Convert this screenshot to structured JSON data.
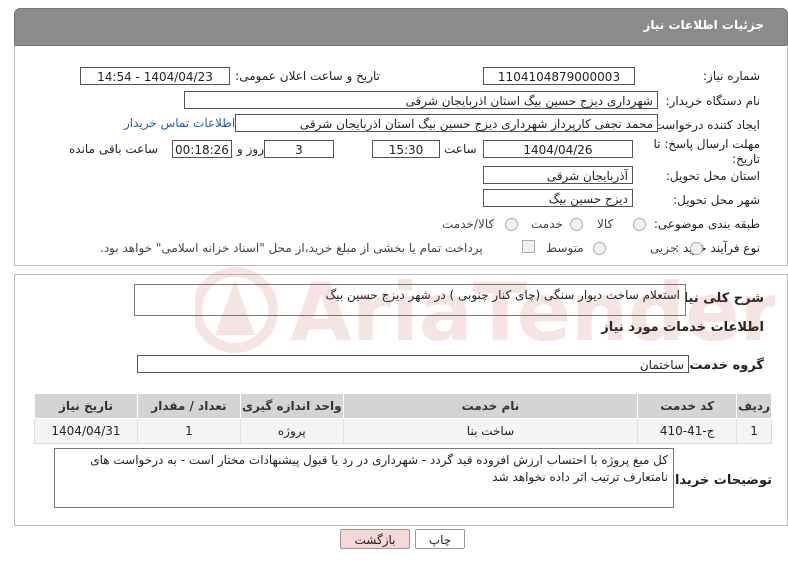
{
  "header": {
    "title": "جزئیات اطلاعات نیاز"
  },
  "fields": {
    "need_number_label": "شماره نیاز:",
    "need_number": "1104104879000003",
    "announce_label": "تاریخ و ساعت اعلان عمومی:",
    "announce_value": "1404/04/23 - 14:54",
    "buyer_label": "نام دستگاه خریدار:",
    "buyer_value": "شهرداری دیزج حسین بیگ استان اذربایجان شرقی",
    "creator_label": "ایجاد کننده درخواست:",
    "creator_value": "محمد نجفی کارپرداز شهرداری دیزج حسین بیگ استان اذربایجان شرقی",
    "contact_link": "اطلاعات تماس خریدار",
    "deadline_label": "مهلت ارسال پاسخ: تا تاریخ:",
    "deadline_date": "1404/04/26",
    "time_label": "ساعت",
    "deadline_time": "15:30",
    "days_value": "3",
    "days_label": "روز و",
    "remaining_value": "00:18:26",
    "remaining_label": "ساعت باقی مانده",
    "province_label": "استان محل تحویل:",
    "province_value": "آذربایجان شرقی",
    "city_label": "شهر محل تحویل:",
    "city_value": "دیزج حسین بیگ",
    "category_label": "طبقه بندی موضوعی:",
    "category_options": [
      "کالا",
      "خدمت",
      "کالا/خدمت"
    ],
    "process_label": "نوع فرآیند خرید :",
    "process_options": [
      "جزیی",
      "متوسط"
    ],
    "payment_note": "پرداخت تمام یا بخشی از مبلغ خرید،از محل \"اسناد خزانه اسلامی\" خواهد بود."
  },
  "description": {
    "label": "شرح کلی نیاز:",
    "value": "استعلام ساخت دیوار سنگی (چای کنار چنوبی ) در شهر دیزج حسین بیگ"
  },
  "services": {
    "section_title": "اطلاعات خدمات مورد نیاز",
    "group_label": "گروه خدمت:",
    "group_value": "ساختمان",
    "columns": [
      "ردیف",
      "کد خدمت",
      "نام خدمت",
      "واحد اندازه گیری",
      "تعداد / مقدار",
      "تاریخ نیاز"
    ],
    "rows": [
      [
        "1",
        "ج-41-410",
        "ساخت بنا",
        "پروژه",
        "1",
        "1404/04/31"
      ]
    ]
  },
  "buyer_notes": {
    "label": "توضیحات خریدار:",
    "value": "کل مبغ پروژه با احتساب ارزش افزوده قید گردد - شهرداری در رد یا قبول پیشنهادات مختار است - به درخواست های نامتعارف ترتیب اثر داده نخواهد شد"
  },
  "buttons": {
    "print": "چاپ",
    "back": "بازگشت"
  },
  "watermark": {
    "text": "AriaTender.neT"
  },
  "colors": {
    "header_bg": "#8b8b8b",
    "link": "#2a5db0",
    "back_btn_bg": "#f7d6d6",
    "watermark": "#c0392b"
  }
}
